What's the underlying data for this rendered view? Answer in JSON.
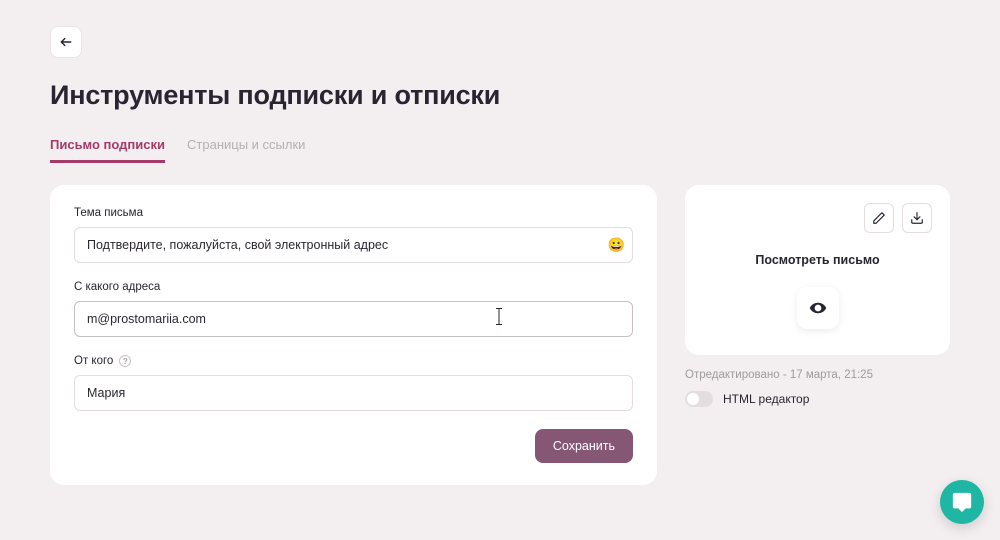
{
  "header": {
    "title": "Инструменты подписки и отписки"
  },
  "tabs": [
    {
      "label": "Письмо подписки",
      "active": true
    },
    {
      "label": "Страницы и ссылки",
      "active": false
    }
  ],
  "form": {
    "subject": {
      "label": "Тема письма",
      "value": "Подтвердите, пожалуйста, свой электронный адрес"
    },
    "from_address": {
      "label": "С какого адреса",
      "value": "m@prostomariia.com"
    },
    "from_name": {
      "label": "От кого",
      "value": "Мария"
    },
    "save_label": "Сохранить"
  },
  "preview": {
    "title": "Посмотреть письмо",
    "edited_text": "Отредактировано - 17 марта, 21:25",
    "toggle_label": "HTML редактор"
  },
  "icons": {
    "emoji": "😀",
    "info": "?"
  }
}
